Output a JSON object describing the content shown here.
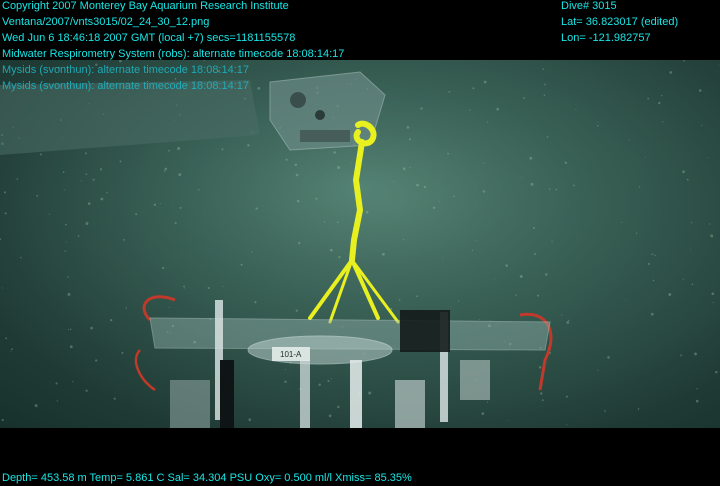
{
  "overlay": {
    "left_lines": [
      "Copyright 2007 Monterey Bay Aquarium Research Institute",
      "Ventana/2007/vnts3015/02_24_30_12.png",
      "Wed Jun  6 18:46:18 2007 GMT (local +7)  secs=1181155578",
      "Midwater Respirometry System (robs): alternate timecode 18:08:14:17",
      "Mysids (svonthun): alternate timecode 18:08:14:17",
      "Mysids (svonthun): alternate timecode 18:08:14:17"
    ],
    "right_lines": [
      "Dive# 3015",
      "Lat= 36.823017 (edited)",
      "Lon= -121.982757"
    ],
    "bottom_line": "Depth= 453.58 m  Temp= 5.861 C  Sal= 34.304 PSU  Oxy= 0.500 ml/l  Xmiss= 85.35%",
    "label_tag": "101-A"
  },
  "colors": {
    "overlay_text": "#19e6e6",
    "water": "#33594f",
    "rope": "#e8f020"
  }
}
